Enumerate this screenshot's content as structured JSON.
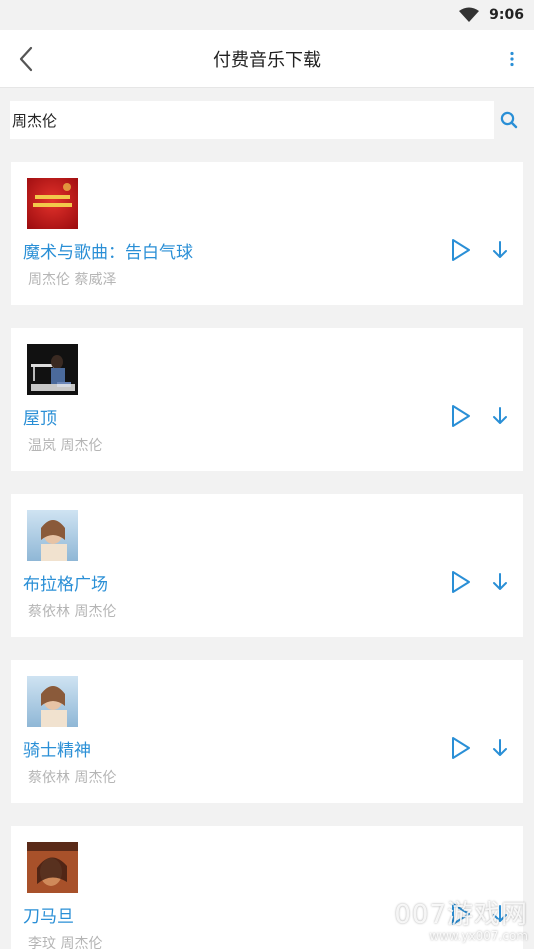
{
  "status_bar": {
    "time": "9:06"
  },
  "app_bar": {
    "title": "付费音乐下载"
  },
  "search": {
    "value": "周杰伦"
  },
  "songs": [
    {
      "title": "魔术与歌曲：告白气球",
      "artist": "周杰伦 蔡威泽",
      "cover": "cover-red-gala"
    },
    {
      "title": "屋顶",
      "artist": "温岚 周杰伦",
      "cover": "cover-dark-piano"
    },
    {
      "title": "布拉格广场",
      "artist": "蔡依林 周杰伦",
      "cover": "cover-portrait-sky"
    },
    {
      "title": "骑士精神",
      "artist": "蔡依林 周杰伦",
      "cover": "cover-portrait-sky"
    },
    {
      "title": "刀马旦",
      "artist": "李玟 周杰伦",
      "cover": "cover-coco"
    }
  ],
  "colors": {
    "accent": "#2a8fd6",
    "artist_text": "#b5b5b5",
    "background": "#f2f2f2"
  },
  "watermark": {
    "main": "007游戏网",
    "sub": "www.yx007.com"
  }
}
